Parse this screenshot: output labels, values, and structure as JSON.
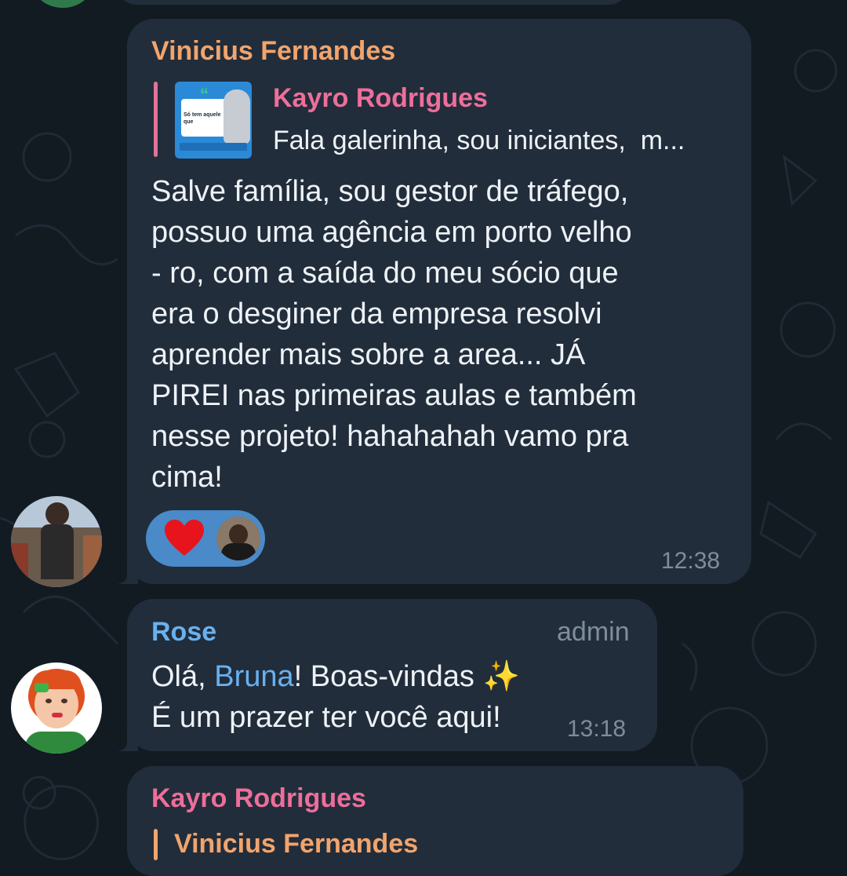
{
  "messages": [
    {
      "sender": "Vinicius Fernandes",
      "reply": {
        "author": "Kayro Rodrigues",
        "preview": "Fala galerinha, sou iniciantes,  m...",
        "thumb_text": "Só tem aquele que"
      },
      "lines": [
        "Salve família, sou gestor de tráfego,",
        "possuo uma agência em porto velho",
        "- ro, com a saída do meu sócio que",
        "era o desginer da empresa resolvi",
        "aprender mais sobre a area... JÁ",
        "PIREI nas primeiras aulas e também",
        "nesse projeto! hahahahah vamo pra",
        "cima!"
      ],
      "reaction_emoji": "❤️",
      "time": "12:38"
    },
    {
      "sender": "Rose",
      "role": "admin",
      "greeting_pre": "Olá, ",
      "mention": "Bruna",
      "greeting_post": "! Boas-vindas ✨",
      "line2": "É um prazer ter você aqui!",
      "time": "13:18"
    },
    {
      "sender": "Kayro Rodrigues",
      "reply_author": "Vinicius Fernandes"
    }
  ],
  "colors": {
    "background": "#121a22",
    "bubble": "#212d3b",
    "vinicius_name": "#f2a46c",
    "kayro_name": "#ee6e9a",
    "rose_name": "#6ab0ee",
    "mention": "#6ab0ee",
    "time": "#7f8d9b",
    "reaction_pill": "#4a8ac8"
  }
}
